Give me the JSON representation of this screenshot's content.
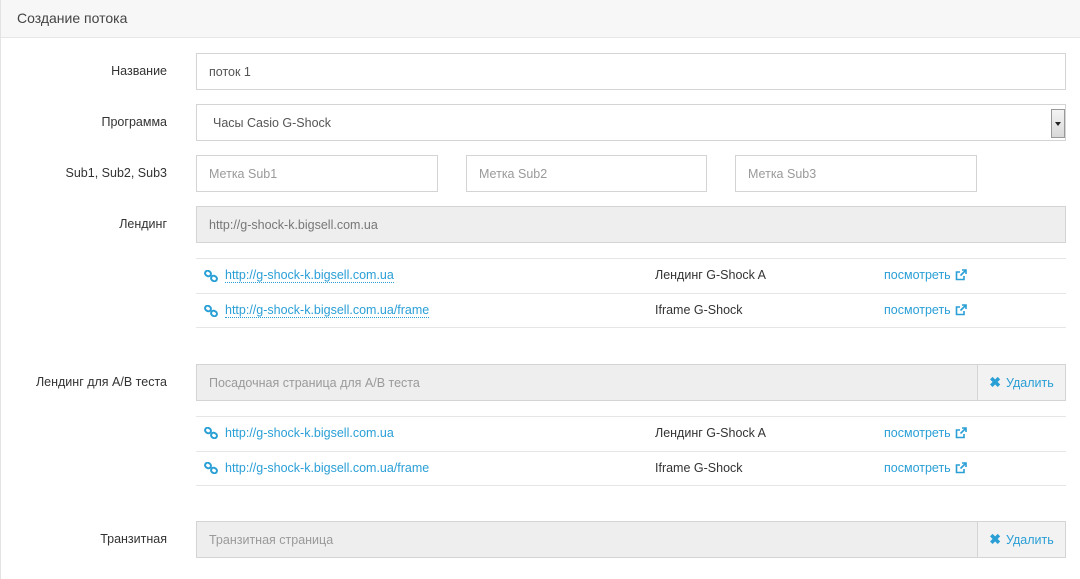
{
  "panel": {
    "title": "Создание потока"
  },
  "form": {
    "name": {
      "label": "Название",
      "value": "поток 1"
    },
    "program": {
      "label": "Программа",
      "selected": "Часы Casio G-Shock"
    },
    "subs": {
      "label": "Sub1, Sub2, Sub3",
      "sub1_placeholder": "Метка Sub1",
      "sub2_placeholder": "Метка Sub2",
      "sub3_placeholder": "Метка Sub3"
    },
    "landing": {
      "label": "Лендинг",
      "value": "http://g-shock-k.bigsell.com.ua",
      "links": [
        {
          "url": "http://g-shock-k.bigsell.com.ua",
          "name": "Лендинг G-Shock A",
          "view": "посмотреть"
        },
        {
          "url": "http://g-shock-k.bigsell.com.ua/frame",
          "name": "Iframe G-Shock",
          "view": "посмотреть"
        }
      ]
    },
    "ab_landing": {
      "label": "Лендинг для A/B теста",
      "placeholder": "Посадочная страница для A/B теста",
      "delete_label": "Удалить",
      "links": [
        {
          "url": "http://g-shock-k.bigsell.com.ua",
          "name": "Лендинг G-Shock A",
          "view": "посмотреть"
        },
        {
          "url": "http://g-shock-k.bigsell.com.ua/frame",
          "name": "Iframe G-Shock",
          "view": "посмотреть"
        }
      ]
    },
    "transit": {
      "label": "Транзитная",
      "placeholder": "Транзитная страница",
      "delete_label": "Удалить"
    }
  },
  "colors": {
    "accent": "#2a9fd6",
    "readonly_bg": "#eeeeee",
    "header_bg": "#f7f7f7"
  },
  "icons": {
    "link": "chain-link-icon",
    "external": "external-link-icon",
    "remove": "times-icon"
  }
}
